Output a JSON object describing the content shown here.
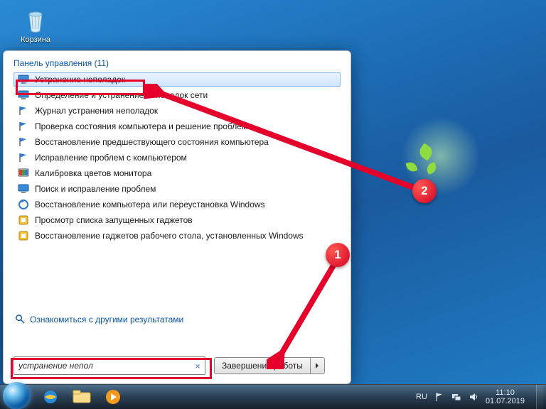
{
  "desktop": {
    "recycle_bin_label": "Корзина"
  },
  "start_menu": {
    "heading": "Панель управления (11)",
    "items": [
      {
        "label": "Устранение неполадок",
        "icon": "monitor"
      },
      {
        "label": "Определение и устранение неполадок сети",
        "icon": "monitor"
      },
      {
        "label": "Журнал устранения неполадок",
        "icon": "flag"
      },
      {
        "label": "Проверка состояния компьютера и решение проблем",
        "icon": "flag"
      },
      {
        "label": "Восстановление предшествующего состояния компьютера",
        "icon": "flag"
      },
      {
        "label": "Исправление проблем с компьютером",
        "icon": "flag"
      },
      {
        "label": "Калибровка цветов монитора",
        "icon": "display"
      },
      {
        "label": "Поиск и исправление проблем",
        "icon": "monitor"
      },
      {
        "label": "Восстановление компьютера или переустановка Windows",
        "icon": "recovery"
      },
      {
        "label": "Просмотр списка запущенных гаджетов",
        "icon": "gadget"
      },
      {
        "label": "Восстановление гаджетов рабочего стола, установленных Windows",
        "icon": "gadget"
      }
    ],
    "more_results": "Ознакомиться с другими результатами",
    "search_value": "устранение непол",
    "shutdown_label": "Завершение работы"
  },
  "tray": {
    "lang": "RU",
    "time": "11:10",
    "date": "01.07.2019"
  },
  "annotations": {
    "bubble1": "1",
    "bubble2": "2"
  }
}
